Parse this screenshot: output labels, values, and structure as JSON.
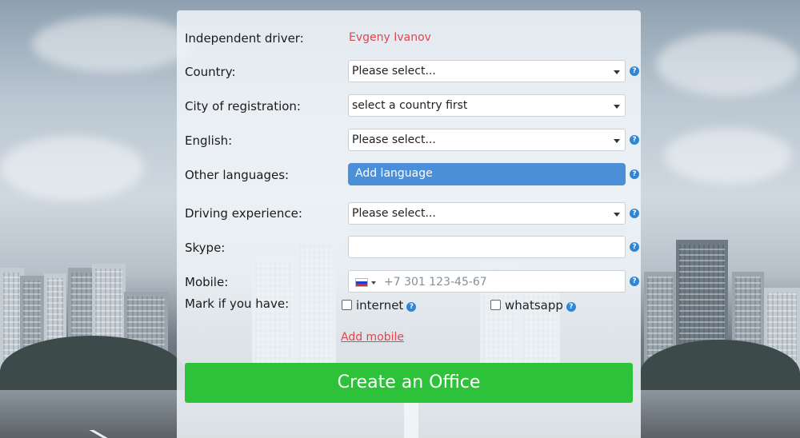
{
  "form": {
    "driver_label": "Independent driver:",
    "driver_name": "Evgeny Ivanov",
    "country_label": "Country:",
    "country_value": "Please select...",
    "city_label": "City of registration:",
    "city_value": "select a country first",
    "english_label": "English:",
    "english_value": "Please select...",
    "languages_label": "Other languages:",
    "add_language_label": "Add language",
    "experience_label": "Driving experience:",
    "experience_value": "Please select...",
    "skype_label": "Skype:",
    "skype_value": "",
    "mobile_label": "Mobile:",
    "mobile_placeholder": "+7 301 123-45-67",
    "mark_label": "Mark if you have:",
    "internet_label": "internet",
    "whatsapp_label": "whatsapp",
    "add_mobile_label": "Add mobile",
    "submit_label": "Create an Office",
    "help_glyph": "?"
  },
  "colors": {
    "accent_blue": "#4a8fd8",
    "submit_green": "#2ec23a",
    "link_red": "#e0464f"
  }
}
